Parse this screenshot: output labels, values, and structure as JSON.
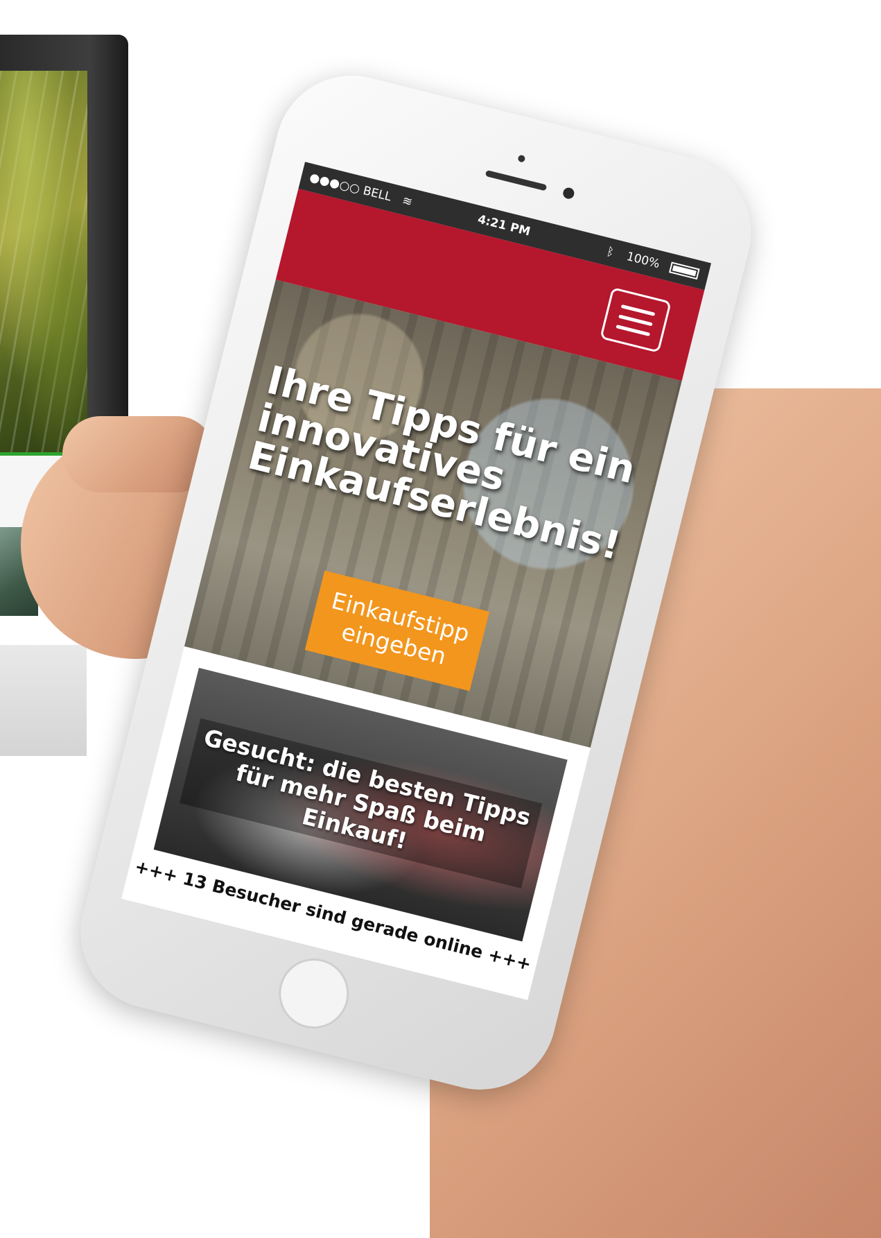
{
  "status_bar": {
    "carrier": "●●●○○ BELL",
    "wifi_icon": "wifi-icon",
    "time": "4:21 PM",
    "bluetooth_icon": "bluetooth-icon",
    "battery": "100%"
  },
  "header": {
    "menu_icon": "hamburger-icon",
    "color": "#b5172d"
  },
  "hero": {
    "title": "Ihre Tipps für ein innovatives Einkaufserlebnis!",
    "cta_label": "Einkaufstipp\neingeben",
    "cta_color": "#f2961e"
  },
  "promo": {
    "title": "Gesucht:  die besten Tipps\nfür mehr Spaß beim Einkauf!"
  },
  "ticker": {
    "text": "+++ 13 Besucher sind gerade online +++"
  }
}
